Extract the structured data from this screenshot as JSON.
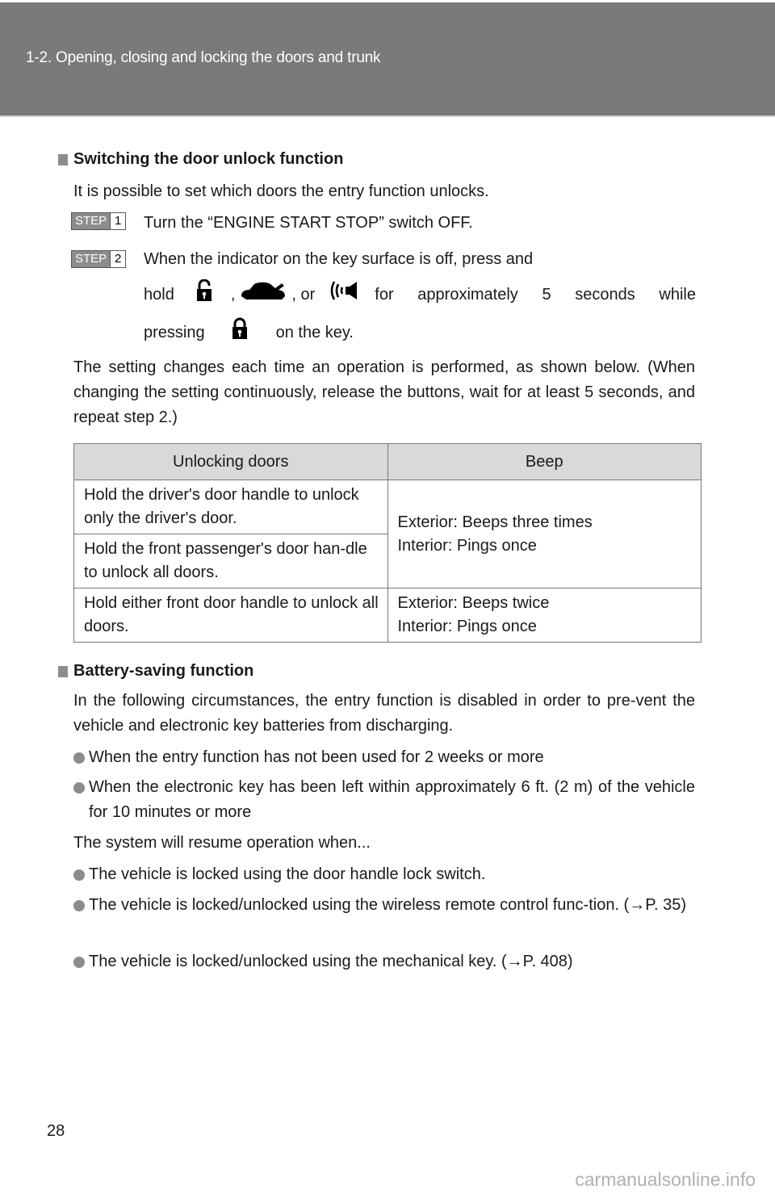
{
  "header": {
    "title": "1-2. Opening, closing and locking the doors and trunk"
  },
  "section1": {
    "title": "Switching the door unlock function",
    "intro": "It is possible to set which doors the entry function unlocks.",
    "steps": [
      {
        "label": "STEP",
        "number": "1",
        "text": "Turn the “ENGINE START STOP” switch OFF."
      },
      {
        "label": "STEP",
        "number": "2",
        "line1": "When the indicator on the key surface is off, press and",
        "hold": "hold",
        "comma1": ",",
        "comma2": ", or",
        "after_icons": "for approximately 5 seconds while",
        "pressing": "pressing",
        "on_key": "on the key.",
        "icons": [
          "unlock-icon",
          "trunk-icon",
          "panic-alarm-icon",
          "lock-icon"
        ]
      }
    ],
    "note": "The setting changes each time an operation is performed, as shown below. (When changing the setting continuously, release the buttons, wait for at least 5 seconds, and repeat step 2.)",
    "table": {
      "headers": [
        "Unlocking doors",
        "Beep"
      ],
      "rows": [
        {
          "unlock": "Hold the driver's door handle to unlock only the driver's door.",
          "beep": "Exterior: Beeps three times",
          "beep2": "Interior: Pings once"
        },
        {
          "unlock": "Hold the front passenger's door han-dle to unlock all doors."
        },
        {
          "unlock": "Hold either front door handle to unlock all doors.",
          "beep": "Exterior: Beeps twice",
          "beep2": "Interior: Pings once"
        }
      ]
    }
  },
  "section2": {
    "title": "Battery-saving function",
    "intro": "In the following circumstances, the entry function is disabled in order to pre-vent the vehicle and electronic key batteries from discharging.",
    "bullets": [
      "When the entry function has not been used for 2 weeks or more",
      "When the electronic key has been left within approximately 6 ft. (2 m) of the vehicle for 10 minutes or more"
    ],
    "resume": "The system will resume operation when...",
    "resume_bullets": [
      "The vehicle is locked using the door handle lock switch.",
      "The vehicle is locked/unlocked using the wireless remote control func-tion. (→P. 35)",
      "The vehicle is locked/unlocked using the mechanical key. (→P. 408)"
    ]
  },
  "footer": {
    "page_number": "28",
    "watermark": "carmanualsonline.info"
  }
}
